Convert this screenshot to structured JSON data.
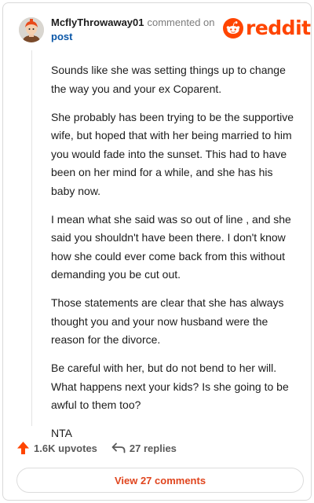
{
  "comment": {
    "author": "McflyThrowaway01",
    "action_text": "commented on",
    "post_link": "post",
    "paragraphs": [
      "Sounds like she was setting things up to change the way you and your ex Coparent.",
      "She probably has been trying to be the supportive wife, but hoped that with her being married to him you would fade into the sunset. This had to have been on her mind for a while, and she has his baby now.",
      "I mean what she said was so out of line , and she said you shouldn't have been there. I don't know how she could ever come back from this without demanding you be cut out.",
      "Those statements are clear that she has always thought you and your now husband were the reason for the divorce.",
      "Be careful with her, but do not bend to her will. What happens next your kids? Is she going to be awful to them too?",
      "NTA"
    ]
  },
  "logo": {
    "word": "reddit"
  },
  "footer": {
    "upvotes": "1.6K upvotes",
    "replies": "27 replies",
    "view_comments": "View 27 comments"
  },
  "colors": {
    "brand": "#ff4500",
    "link": "#0b57a8",
    "button_text": "#e0451e"
  },
  "icons": {
    "upvote": "upvote-arrow-icon",
    "reply": "reply-arrow-icon",
    "logo": "reddit-snoo-icon"
  }
}
